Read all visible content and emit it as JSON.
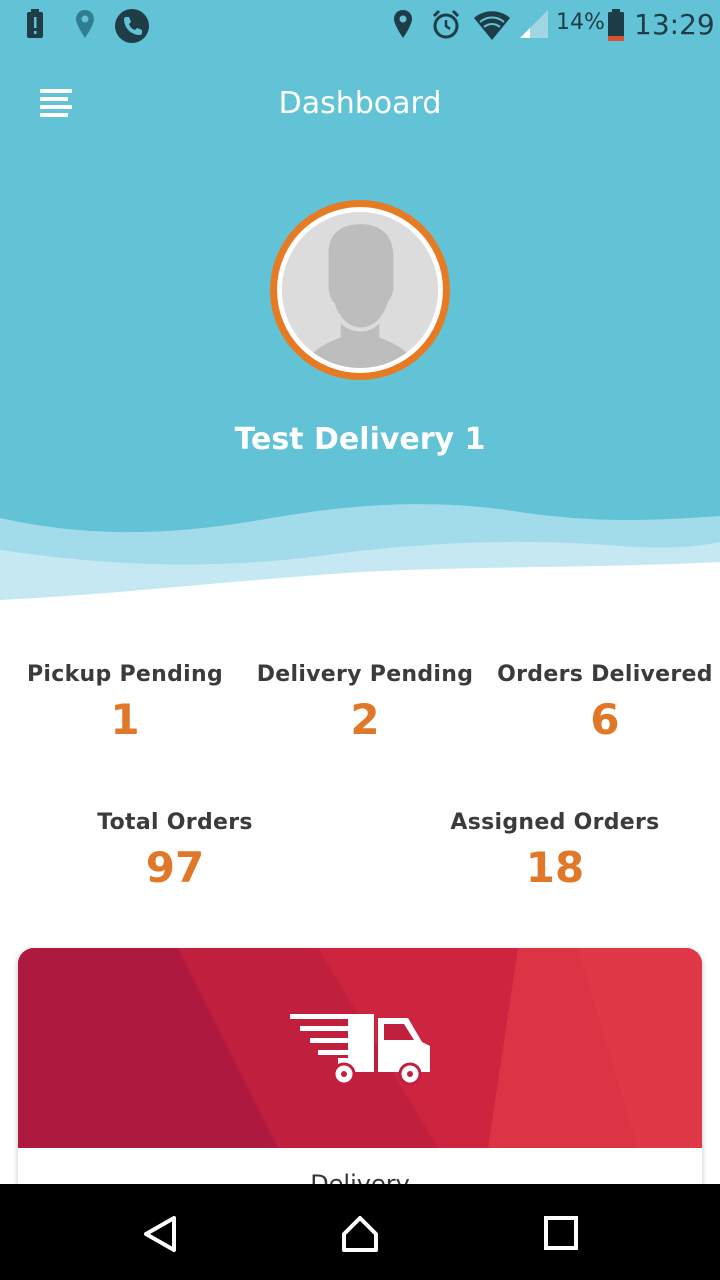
{
  "status_bar": {
    "battery_percent": "14%",
    "time": "13:29",
    "icons": [
      "battery-alert-icon",
      "location-icon",
      "phone-icon",
      "location-icon",
      "alarm-icon",
      "wifi-icon",
      "signal-icon",
      "battery-icon"
    ]
  },
  "app_bar": {
    "title": "Dashboard",
    "menu_icon": "menu-icon"
  },
  "profile": {
    "name": "Test Delivery 1",
    "avatar_icon": "avatar-placeholder"
  },
  "stats": [
    {
      "label": "Pickup Pending",
      "value": "1"
    },
    {
      "label": "Delivery Pending",
      "value": "2"
    },
    {
      "label": "Orders Delivered",
      "value": "6"
    },
    {
      "label": "Total Orders",
      "value": "97"
    },
    {
      "label": "Assigned Orders",
      "value": "18"
    }
  ],
  "card": {
    "label": "Delivery",
    "icon": "delivery-truck-icon"
  },
  "nav_bar": {
    "buttons": [
      "back-icon",
      "home-icon",
      "recents-icon"
    ]
  },
  "colors": {
    "header": "#62c3d6",
    "accent": "#e0782a",
    "avatar_ring": "#e67b24",
    "card_red": "#c8203e"
  }
}
